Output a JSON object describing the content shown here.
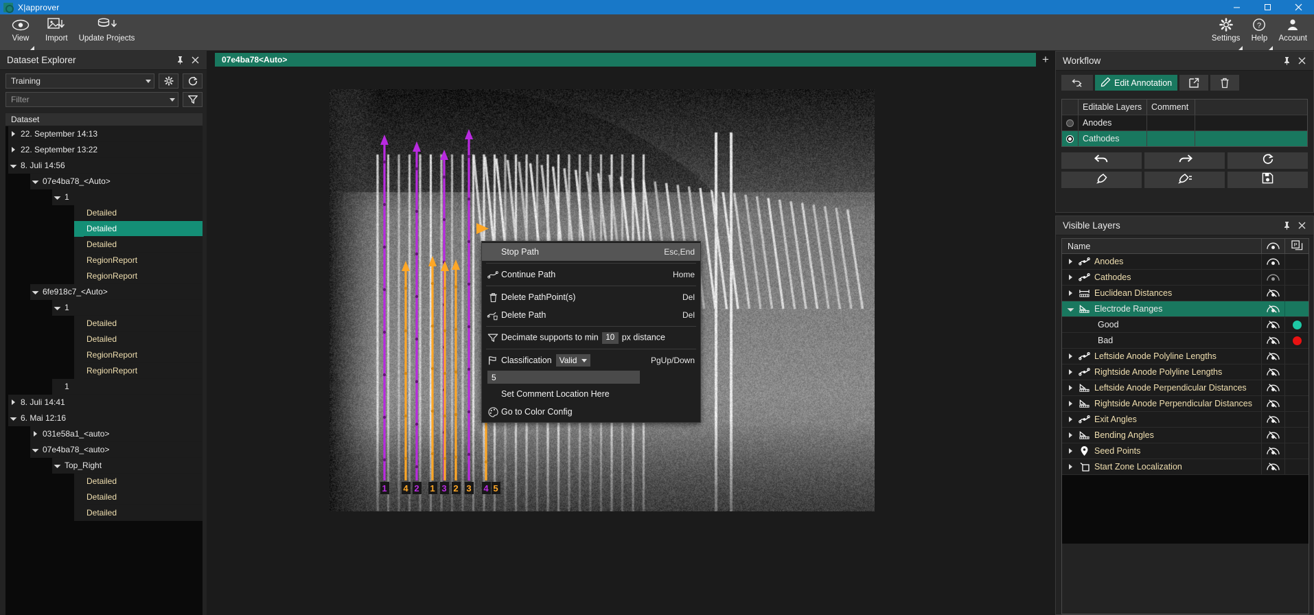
{
  "window": {
    "title": "X|approver",
    "minimize": "minimize-icon",
    "maximize": "maximize-icon",
    "close": "close-icon"
  },
  "ribbon": {
    "left_items": [
      {
        "label": "View",
        "icon": "eye-icon",
        "has_caret": true
      },
      {
        "label": "Import",
        "icon": "image-import-icon",
        "has_caret": false
      },
      {
        "label": "Update Projects",
        "icon": "database-update-icon",
        "has_caret": false
      }
    ],
    "right_items": [
      {
        "label": "Settings",
        "icon": "gear-icon",
        "has_caret": true
      },
      {
        "label": "Help",
        "icon": "question-circle-icon",
        "has_caret": true
      },
      {
        "label": "Account",
        "icon": "person-icon",
        "has_caret": false
      }
    ]
  },
  "dataset_explorer": {
    "title": "Dataset Explorer",
    "pin": "pin-icon",
    "close": "close-icon",
    "dataset_select": {
      "value": "Training"
    },
    "settings_button": "gear-icon",
    "refresh_button": "refresh-icon",
    "filter_select": {
      "placeholder": "Filter"
    },
    "filter_button": "funnel-icon",
    "tree_header": "Dataset",
    "tree": [
      {
        "label": "22. September 14:13",
        "depth": 0,
        "arrow": "right",
        "kind": "node"
      },
      {
        "label": "22. September 13:22",
        "depth": 0,
        "arrow": "right",
        "kind": "node"
      },
      {
        "label": "8. Juli 14:56",
        "depth": 0,
        "arrow": "down",
        "kind": "node"
      },
      {
        "label": "07e4ba78_<Auto>",
        "depth": 1,
        "arrow": "down",
        "kind": "node"
      },
      {
        "label": "1",
        "depth": 2,
        "arrow": "down",
        "kind": "node"
      },
      {
        "label": "Detailed",
        "depth": 3,
        "arrow": "none",
        "kind": "leaf"
      },
      {
        "label": "Detailed",
        "depth": 3,
        "arrow": "none",
        "kind": "leaf",
        "selected": true
      },
      {
        "label": "Detailed",
        "depth": 3,
        "arrow": "none",
        "kind": "leaf"
      },
      {
        "label": "RegionReport",
        "depth": 3,
        "arrow": "none",
        "kind": "leaf"
      },
      {
        "label": "RegionReport",
        "depth": 3,
        "arrow": "none",
        "kind": "leaf"
      },
      {
        "label": "6fe918c7_<Auto>",
        "depth": 1,
        "arrow": "down",
        "kind": "node"
      },
      {
        "label": "1",
        "depth": 2,
        "arrow": "down",
        "kind": "node"
      },
      {
        "label": "Detailed",
        "depth": 3,
        "arrow": "none",
        "kind": "leaf"
      },
      {
        "label": "Detailed",
        "depth": 3,
        "arrow": "none",
        "kind": "leaf"
      },
      {
        "label": "RegionReport",
        "depth": 3,
        "arrow": "none",
        "kind": "leaf"
      },
      {
        "label": "RegionReport",
        "depth": 3,
        "arrow": "none",
        "kind": "leaf"
      },
      {
        "label": "1",
        "depth": 2,
        "arrow": "none",
        "kind": "node"
      },
      {
        "label": "8. Juli 14:41",
        "depth": 0,
        "arrow": "right",
        "kind": "node"
      },
      {
        "label": "6. Mai 12:16",
        "depth": 0,
        "arrow": "down",
        "kind": "node"
      },
      {
        "label": "031e58a1_<auto>",
        "depth": 1,
        "arrow": "right",
        "kind": "node"
      },
      {
        "label": "07e4ba78_<auto>",
        "depth": 1,
        "arrow": "down",
        "kind": "node"
      },
      {
        "label": "Top_Right",
        "depth": 2,
        "arrow": "down",
        "kind": "node"
      },
      {
        "label": "Detailed",
        "depth": 3,
        "arrow": "none",
        "kind": "leaf"
      },
      {
        "label": "Detailed",
        "depth": 3,
        "arrow": "none",
        "kind": "leaf"
      },
      {
        "label": "Detailed",
        "depth": 3,
        "arrow": "none",
        "kind": "leaf"
      }
    ]
  },
  "viewer": {
    "tab_label": "07e4ba78<Auto>",
    "add_tab": "+",
    "annotations": {
      "cathode_color": "#b92ae0",
      "anode_color": "#ffa726",
      "labels": [
        {
          "text": "1",
          "color": "#b92ae0"
        },
        {
          "text": "4",
          "color": "#ffa726"
        },
        {
          "text": "2",
          "color": "#b92ae0"
        },
        {
          "text": "1",
          "color": "#ffa726"
        },
        {
          "text": "3",
          "color": "#b92ae0"
        },
        {
          "text": "2",
          "color": "#ffa726"
        },
        {
          "text": "3",
          "color": "#ffa726"
        },
        {
          "text": "4",
          "color": "#b92ae0"
        },
        {
          "text": "5",
          "color": "#ffa726"
        }
      ]
    }
  },
  "context_menu": {
    "items": [
      {
        "label": "Stop Path",
        "shortcut": "Esc,End",
        "icon": "",
        "highlighted": true
      },
      {
        "separator": true
      },
      {
        "label": "Continue Path",
        "shortcut": "Home",
        "icon": "path-icon"
      },
      {
        "separator": true
      },
      {
        "label": "Delete PathPoint(s)",
        "shortcut": "Del",
        "icon": "trash-icon"
      },
      {
        "label": "Delete Path",
        "shortcut": "Del",
        "icon": "path-delete-icon"
      },
      {
        "separator": true
      },
      {
        "label": "Decimate supports to min",
        "suffix": "px distance",
        "value": "10",
        "icon": "funnel-icon"
      },
      {
        "separator": true
      },
      {
        "label": "Classification",
        "shortcut": "PgUp/Down",
        "select_value": "Valid",
        "icon": "flag-icon"
      },
      {
        "comment_value": "5"
      },
      {
        "label": "Set Comment Location Here",
        "icon": ""
      },
      {
        "label": "Go to Color Config",
        "icon": "palette-icon"
      }
    ]
  },
  "workflow": {
    "title": "Workflow",
    "pin": "pin-icon",
    "close": "close-icon",
    "toolbar": {
      "revert_label": "",
      "revert_icon": "undo-arrows-icon",
      "edit_label": "Edit Annotation",
      "edit_icon": "pencil-icon",
      "open_icon": "open-external-icon",
      "delete_icon": "trash-icon"
    },
    "table": {
      "columns": [
        "",
        "Editable Layers",
        "Comment",
        ""
      ],
      "rows": [
        {
          "name": "Anodes",
          "selected": false,
          "radio": false,
          "comment": ""
        },
        {
          "name": "Cathodes",
          "selected": true,
          "radio": true,
          "comment": ""
        }
      ]
    },
    "buttons": [
      {
        "icon": "undo-icon",
        "name": "undo-button"
      },
      {
        "icon": "redo-icon",
        "name": "redo-button"
      },
      {
        "icon": "reload-icon",
        "name": "reload-button"
      },
      {
        "icon": "brush-icon",
        "name": "clean-button"
      },
      {
        "icon": "brush-dash-icon",
        "name": "clean-partial-button"
      },
      {
        "icon": "save-icon",
        "name": "save-button"
      }
    ]
  },
  "visible_layers": {
    "title": "Visible Layers",
    "pin": "pin-icon",
    "close": "close-icon",
    "columns": {
      "name": "Name",
      "eye": "eye-icon",
      "prop": "properties-icon"
    },
    "rows": [
      {
        "label": "Anodes",
        "depth": 0,
        "arrow": "right",
        "icon": "polyline-icon",
        "eye": "visible",
        "tan": true
      },
      {
        "label": "Cathodes",
        "depth": 0,
        "arrow": "right",
        "icon": "polyline-icon",
        "eye": "dim",
        "tan": true
      },
      {
        "label": "Euclidean Distances",
        "depth": 0,
        "arrow": "right",
        "icon": "measure-icon",
        "eye": "hidden",
        "tan": true
      },
      {
        "label": "Electrode Ranges",
        "depth": 0,
        "arrow": "down",
        "icon": "range-icon",
        "eye": "hidden",
        "selected": true
      },
      {
        "label": "Good",
        "depth": 1,
        "arrow": "none",
        "icon": "",
        "eye": "hidden",
        "swatch": "#1ec8a5"
      },
      {
        "label": "Bad",
        "depth": 1,
        "arrow": "none",
        "icon": "",
        "eye": "hidden",
        "swatch": "#e81212"
      },
      {
        "label": "Leftside Anode Polyline Lengths",
        "depth": 0,
        "arrow": "right",
        "icon": "polyline-icon",
        "eye": "hidden",
        "tan": true
      },
      {
        "label": "Rightside Anode Polyline Lengths",
        "depth": 0,
        "arrow": "right",
        "icon": "polyline-icon",
        "eye": "hidden",
        "tan": true
      },
      {
        "label": "Leftside Anode Perpendicular Distances",
        "depth": 0,
        "arrow": "right",
        "icon": "range-icon",
        "eye": "hidden",
        "tan": true
      },
      {
        "label": "Rightside Anode Perpendicular Distances",
        "depth": 0,
        "arrow": "right",
        "icon": "range-icon",
        "eye": "hidden",
        "tan": true
      },
      {
        "label": "Exit Angles",
        "depth": 0,
        "arrow": "right",
        "icon": "polyline-icon",
        "eye": "hidden",
        "tan": true
      },
      {
        "label": "Bending Angles",
        "depth": 0,
        "arrow": "right",
        "icon": "range-icon",
        "eye": "hidden",
        "tan": true
      },
      {
        "label": "Seed Points",
        "depth": 0,
        "arrow": "right",
        "icon": "pin-marker-icon",
        "eye": "hidden",
        "tan": true
      },
      {
        "label": "Start Zone Localization",
        "depth": 0,
        "arrow": "right",
        "icon": "zone-icon",
        "eye": "hidden",
        "tan": true
      }
    ]
  },
  "colors": {
    "accent_teal": "#19785f",
    "title_blue": "#1878c8",
    "cathode_purple": "#b92ae0",
    "anode_orange": "#ffa726",
    "good": "#1ec8a5",
    "bad": "#e81212"
  }
}
